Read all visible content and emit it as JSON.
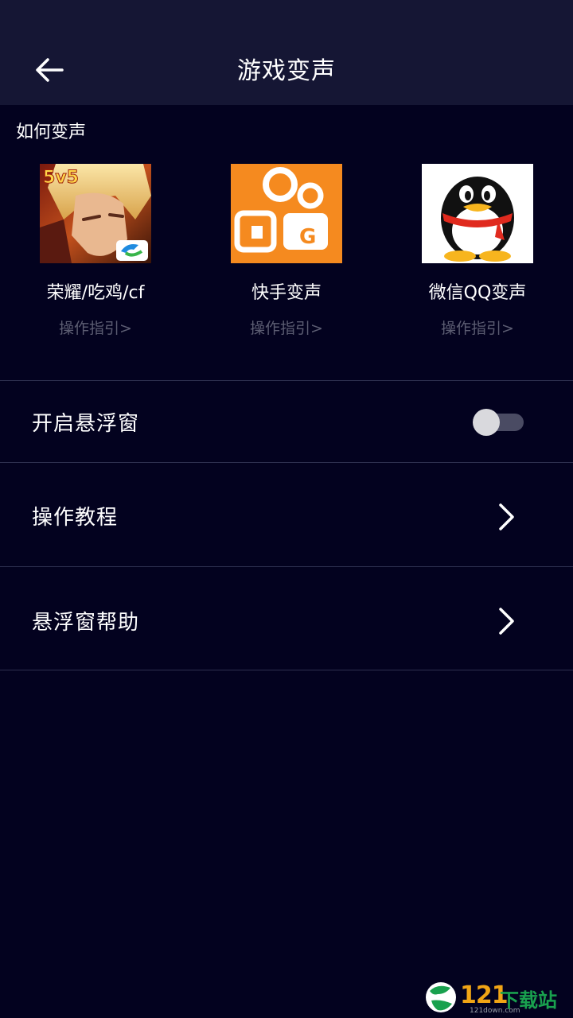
{
  "header": {
    "title": "游戏变声",
    "back_icon": "arrow-left-icon"
  },
  "how_section": {
    "label": "如何变声",
    "apps": [
      {
        "name": "荣耀/吃鸡/cf",
        "guide": "操作指引>",
        "icon": "honor-of-kings-icon"
      },
      {
        "name": "快手变声",
        "guide": "操作指引>",
        "icon": "kuaishou-icon"
      },
      {
        "name": "微信QQ变声",
        "guide": "操作指引>",
        "icon": "qq-penguin-icon"
      }
    ]
  },
  "settings": {
    "float_window": {
      "label": "开启悬浮窗",
      "enabled": false
    },
    "tutorial": {
      "label": "操作教程",
      "icon": "chevron-right-icon"
    },
    "float_help": {
      "label": "悬浮窗帮助",
      "icon": "chevron-right-icon"
    }
  },
  "watermark": {
    "text": "121",
    "text2": "下载站",
    "sub": "121down.com"
  },
  "colors": {
    "background": "#03021f",
    "header": "#151634",
    "kuaishou_orange": "#f58a1f",
    "muted_text": "#5c5d72"
  }
}
